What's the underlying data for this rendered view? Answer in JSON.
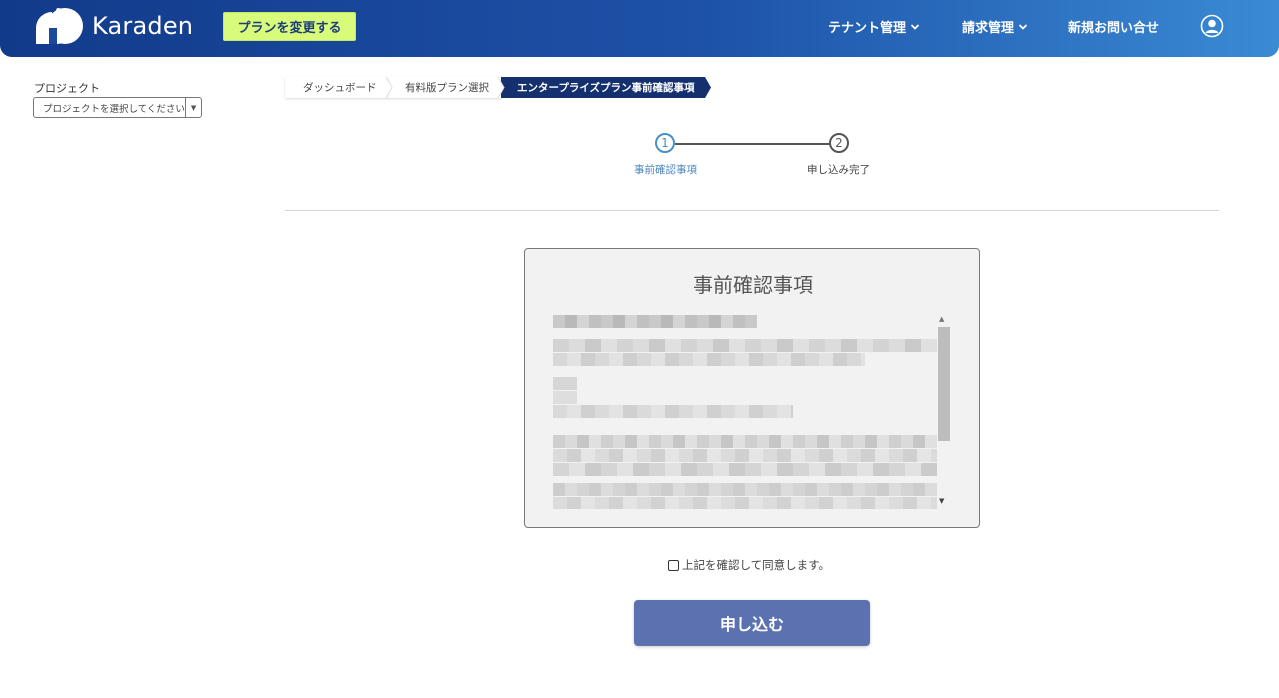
{
  "header": {
    "logo_text": "Karaden",
    "plan_button": "プランを変更する",
    "nav": [
      {
        "label": "テナント管理",
        "has_dropdown": true
      },
      {
        "label": "請求管理",
        "has_dropdown": true
      },
      {
        "label": "新規お問い合せ",
        "has_dropdown": false
      }
    ],
    "user_icon": "user-circle-icon"
  },
  "sidebar": {
    "project_label": "プロジェクト",
    "project_select_value": "プロジェクトを選択してください"
  },
  "breadcrumb": [
    "ダッシュボード",
    "有料版プラン選択",
    "エンタープライズプラン事前確認事項"
  ],
  "stepper": {
    "steps": [
      {
        "number": "1",
        "label": "事前確認事項",
        "active": true
      },
      {
        "number": "2",
        "label": "申し込み完了",
        "active": false
      }
    ]
  },
  "terms": {
    "title": "事前確認事項",
    "content_obscured": true
  },
  "agree_label": "上記を確認して同意します。",
  "agree_checked": false,
  "submit_button": "申し込む",
  "colors": {
    "header_start": "#123a8a",
    "header_end": "#3a8ad4",
    "plan_button_bg": "#d9fb7a",
    "breadcrumb_active": "#14306f",
    "step_active": "#4a90c8",
    "submit_bg": "#5c72b0"
  }
}
